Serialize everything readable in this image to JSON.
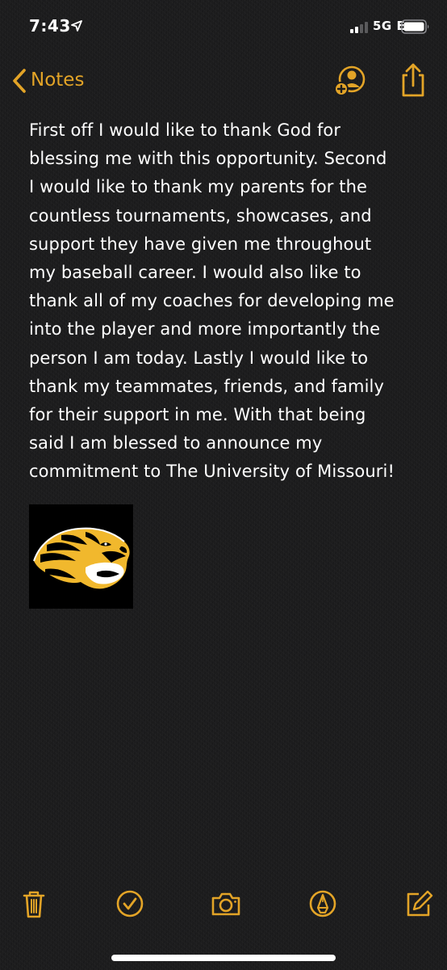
{
  "status_bar": {
    "time": "7:43",
    "network": "5G E",
    "icons": [
      "location-arrow-icon",
      "signal-bars-icon",
      "battery-icon"
    ]
  },
  "nav": {
    "back_label": "Notes",
    "back_icon": "chevron-left-icon",
    "add_people_icon": "add-people-icon",
    "share_icon": "share-icon"
  },
  "note": {
    "body": "First off I would like to thank God for\nblessing me with this opportunity. Second\nI would like to thank my parents for the\ncountless tournaments, showcases, and\nsupport they have given me throughout\nmy baseball career. I would also like to\nthank all of my coaches for developing me\ninto the player and more importantly the\nperson I am today. Lastly I would like to\nthank my teammates, friends, and family\nfor their support in me. With that being\nsaid I am blessed to announce my\ncommitment to The University of Missouri!",
    "image": "tiger-logo"
  },
  "toolbar": {
    "items": [
      "trash-icon",
      "checklist-icon",
      "camera-icon",
      "markup-icon",
      "compose-icon"
    ]
  },
  "colors": {
    "accent": "#e3a427",
    "background": "#1c1c1d",
    "text": "#ffffff",
    "logo_gold": "#f1b82d"
  }
}
